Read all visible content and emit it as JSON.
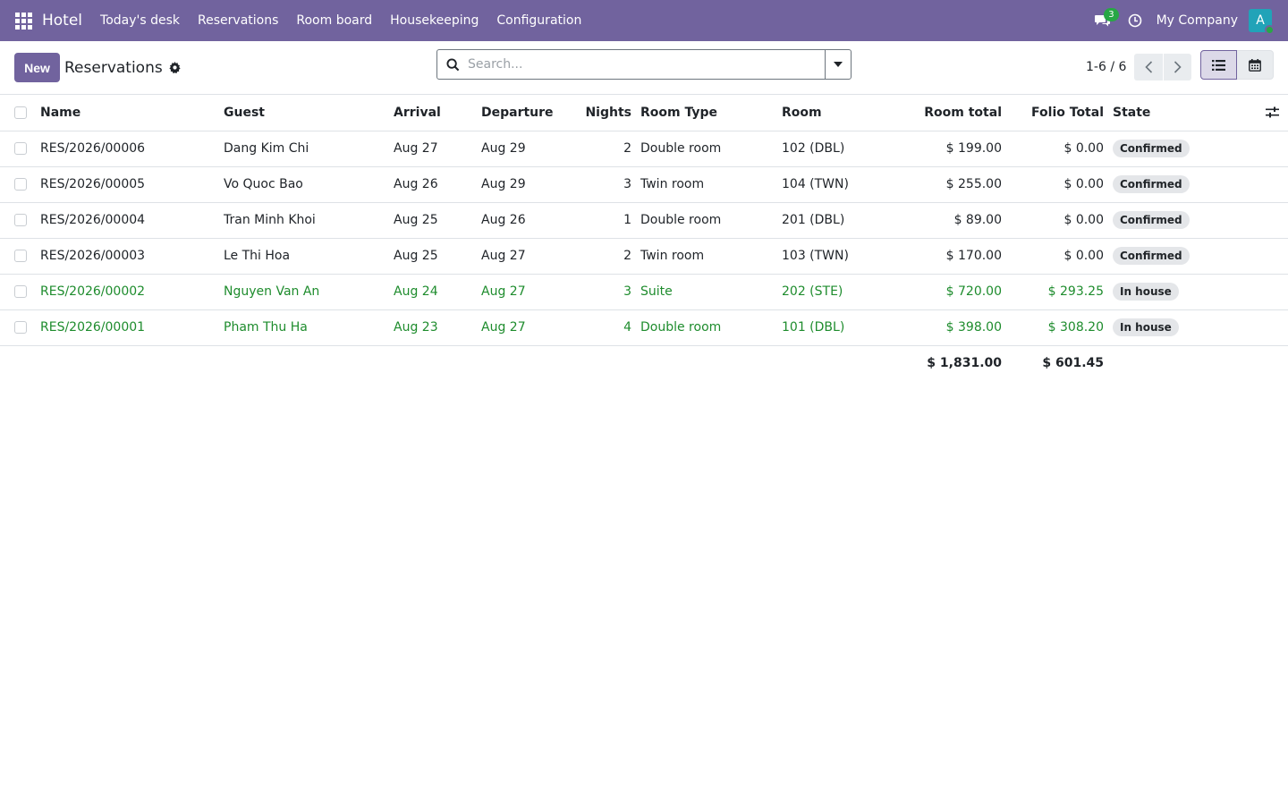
{
  "navbar": {
    "app_name": "Hotel",
    "menu": [
      "Today's desk",
      "Reservations",
      "Room board",
      "Housekeeping",
      "Configuration"
    ],
    "chat_count": "3",
    "company": "My Company",
    "avatar_letter": "A",
    "color": "#71639e"
  },
  "control": {
    "new_label": "New",
    "title": "Reservations",
    "search_placeholder": "Search...",
    "pager": "1-6 / 6"
  },
  "table": {
    "headers": {
      "name": "Name",
      "guest": "Guest",
      "arrival": "Arrival",
      "departure": "Departure",
      "nights": "Nights",
      "room_type": "Room Type",
      "room": "Room",
      "room_total": "Room total",
      "folio_total": "Folio Total",
      "state": "State"
    },
    "rows": [
      {
        "name": "RES/2026/00006",
        "guest": "Dang Kim Chi",
        "arrival": "Aug 27",
        "departure": "Aug 29",
        "nights": "2",
        "room_type": "Double room",
        "room": "102 (DBL)",
        "room_total": "$ 199.00",
        "folio_total": "$ 0.00",
        "state": "Confirmed"
      },
      {
        "name": "RES/2026/00005",
        "guest": "Vo Quoc Bao",
        "arrival": "Aug 26",
        "departure": "Aug 29",
        "nights": "3",
        "room_type": "Twin room",
        "room": "104 (TWN)",
        "room_total": "$ 255.00",
        "folio_total": "$ 0.00",
        "state": "Confirmed"
      },
      {
        "name": "RES/2026/00004",
        "guest": "Tran Minh Khoi",
        "arrival": "Aug 25",
        "departure": "Aug 26",
        "nights": "1",
        "room_type": "Double room",
        "room": "201 (DBL)",
        "room_total": "$ 89.00",
        "folio_total": "$ 0.00",
        "state": "Confirmed"
      },
      {
        "name": "RES/2026/00003",
        "guest": "Le Thi Hoa",
        "arrival": "Aug 25",
        "departure": "Aug 27",
        "nights": "2",
        "room_type": "Twin room",
        "room": "103 (TWN)",
        "room_total": "$ 170.00",
        "folio_total": "$ 0.00",
        "state": "Confirmed"
      },
      {
        "name": "RES/2026/00002",
        "guest": "Nguyen Van An",
        "arrival": "Aug 24",
        "departure": "Aug 27",
        "nights": "3",
        "room_type": "Suite",
        "room": "202 (STE)",
        "room_total": "$ 720.00",
        "folio_total": "$ 293.25",
        "state": "In house"
      },
      {
        "name": "RES/2026/00001",
        "guest": "Pham Thu Ha",
        "arrival": "Aug 23",
        "departure": "Aug 27",
        "nights": "4",
        "room_type": "Double room",
        "room": "101 (DBL)",
        "room_total": "$ 398.00",
        "folio_total": "$ 308.20",
        "state": "In house"
      }
    ],
    "totals": {
      "room_total": "$ 1,831.00",
      "folio_total": "$ 601.45"
    }
  },
  "colors": {
    "in_house_text": "#1e8c2d",
    "brand": "#71639e"
  }
}
